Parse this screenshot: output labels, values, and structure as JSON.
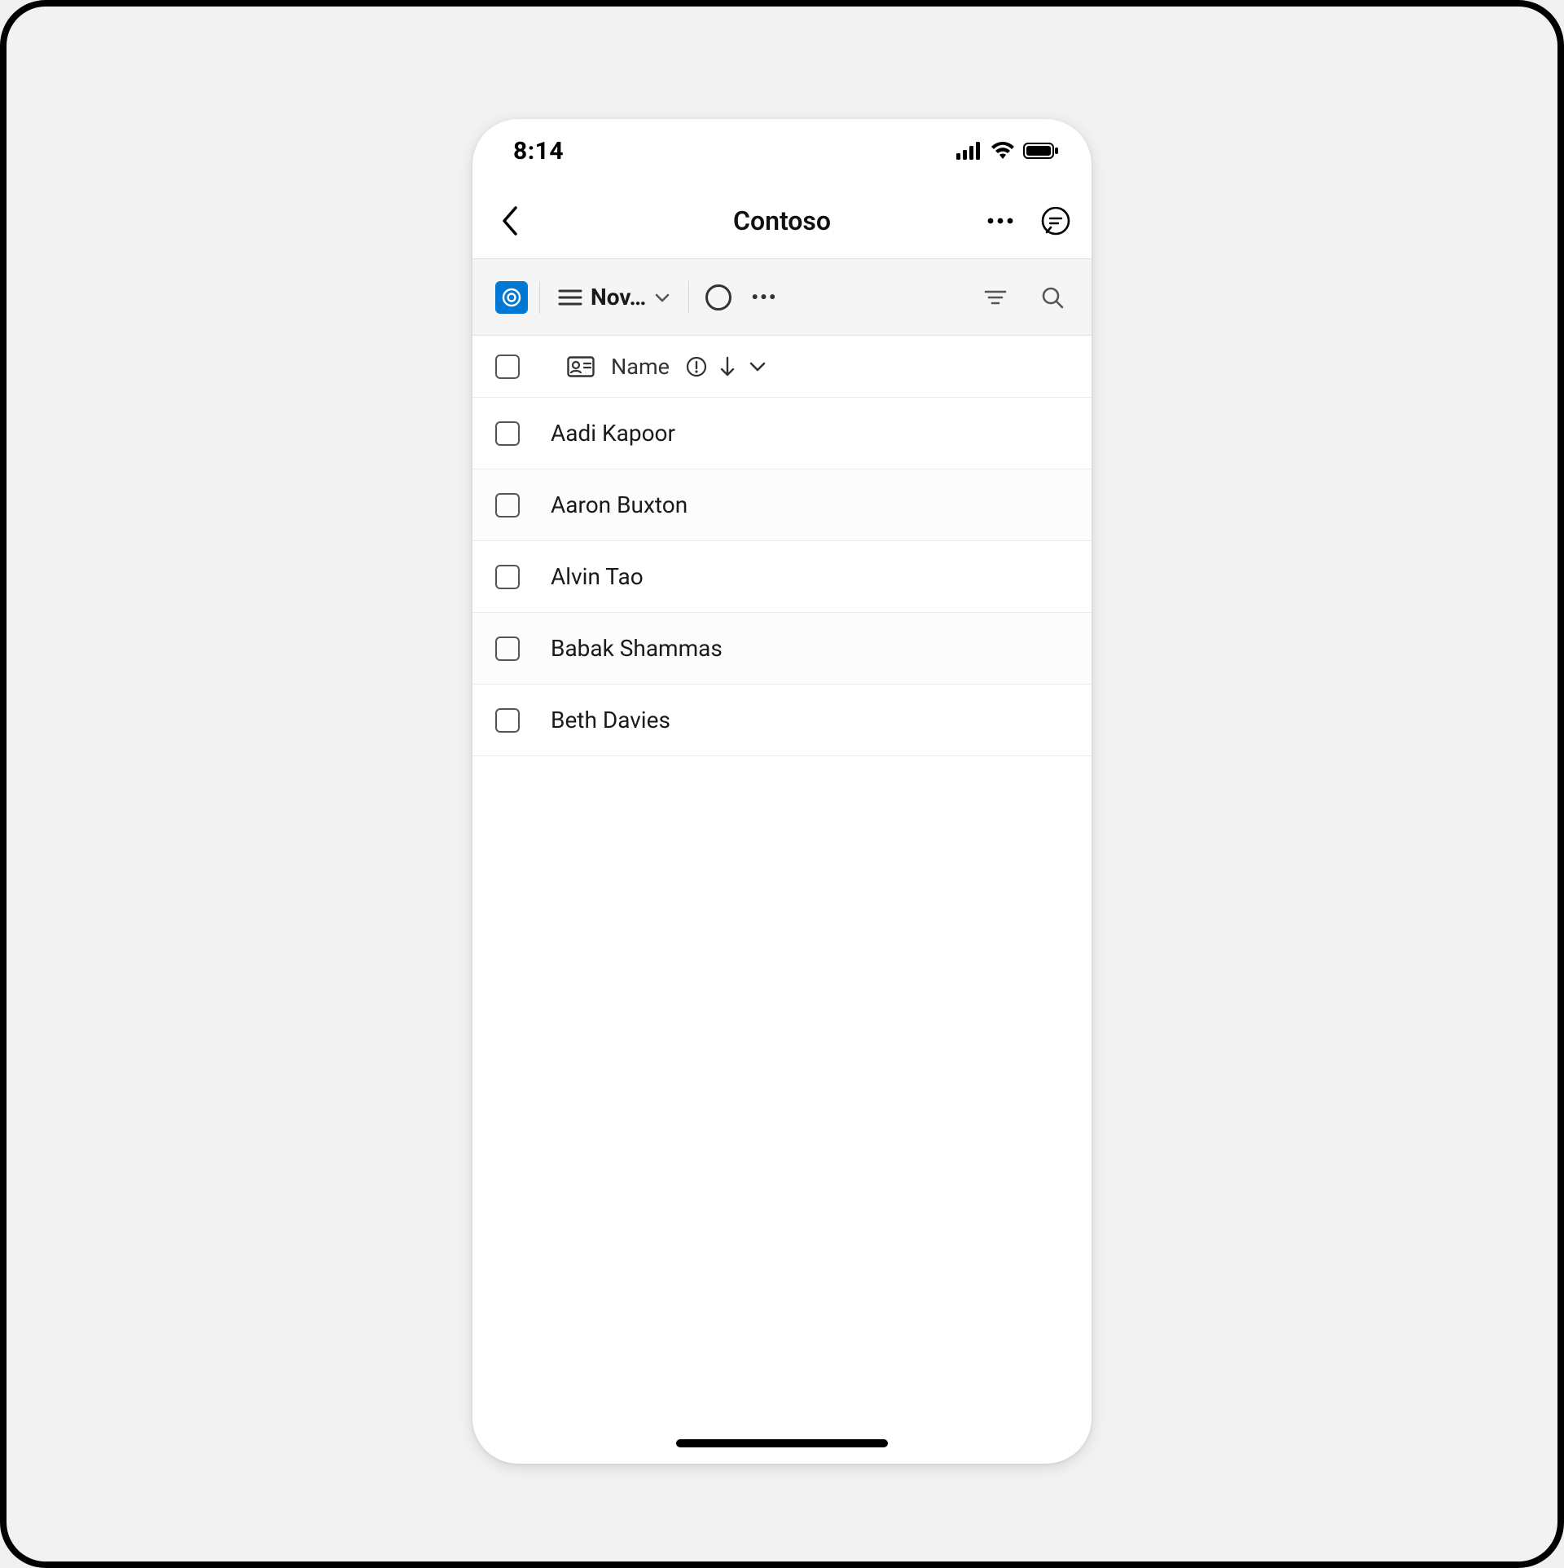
{
  "status_bar": {
    "time": "8:14"
  },
  "header": {
    "title": "Contoso"
  },
  "command_bar": {
    "view_label": "Nov…"
  },
  "columns": {
    "name_label": "Name"
  },
  "rows": [
    {
      "name": "Aadi Kapoor"
    },
    {
      "name": "Aaron Buxton"
    },
    {
      "name": "Alvin Tao"
    },
    {
      "name": "Babak Shammas"
    },
    {
      "name": "Beth Davies"
    }
  ]
}
